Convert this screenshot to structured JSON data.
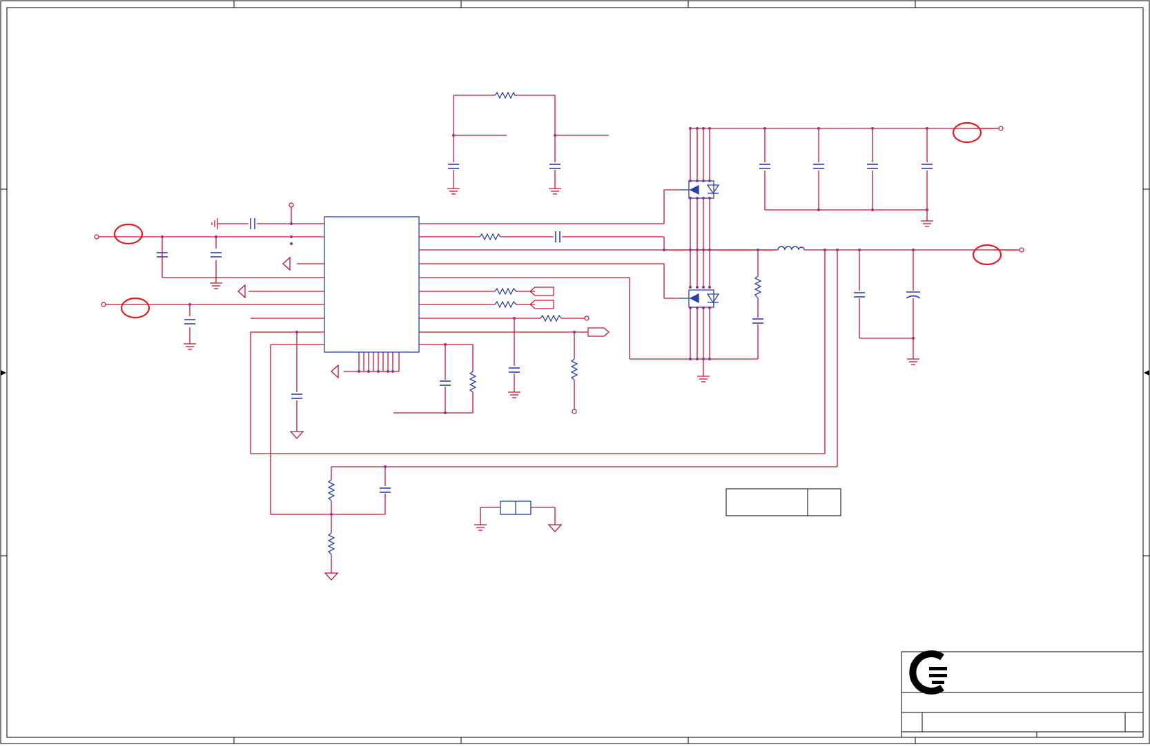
{
  "sheet": {
    "background": "#ffffff",
    "border_color": "#000000",
    "zone_columns": 5,
    "zone_rows": 4
  },
  "colors": {
    "wire": "#c8102e",
    "component": "#2a3fa8",
    "junction": "#9b2d8e",
    "highlight_circle": "#e01b24",
    "frame": "#000000"
  },
  "title_block": {
    "logo_icon": "company-logo-icon",
    "title": "",
    "size": "",
    "document_number": "",
    "revision": "",
    "date": "",
    "sheet": ""
  },
  "note_box": {
    "left_text": "",
    "right_text": ""
  },
  "regulator_ic": {
    "label": ""
  }
}
